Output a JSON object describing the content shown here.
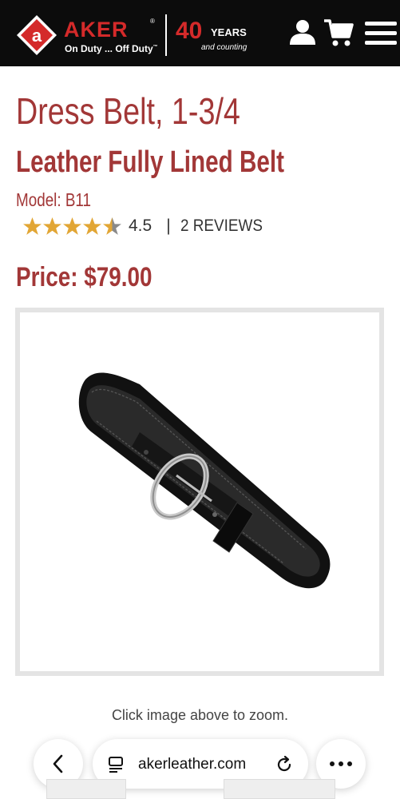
{
  "header": {
    "brand_logo_letter": "a",
    "brand_name": "AKER",
    "brand_registered": "®",
    "tagline": "On Duty ... Off Duty",
    "tagline_tm": "™",
    "anniversary_number": "40",
    "anniversary_years": "YEARS",
    "anniversary_sub": "and counting",
    "icons": [
      "user-icon",
      "cart-icon",
      "menu-icon"
    ],
    "accent_color": "#d42a2a"
  },
  "product": {
    "title": "Dress Belt, 1-3/4",
    "subtitle": "Leather Fully Lined Belt",
    "model": "Model: B11",
    "rating_value": "4.5",
    "rating_stars": 4.5,
    "rating_max": 5,
    "separator": "|",
    "reviews": "2 REVIEWS",
    "price": "Price: $79.00",
    "text_color": "#a23737",
    "star_color": "#e2a635"
  },
  "image": {
    "zoom_hint": "Click image above to zoom."
  },
  "browser": {
    "url": "akerleather.com",
    "icons": [
      "back-icon",
      "tabs-icon",
      "reload-icon",
      "more-icon"
    ]
  }
}
